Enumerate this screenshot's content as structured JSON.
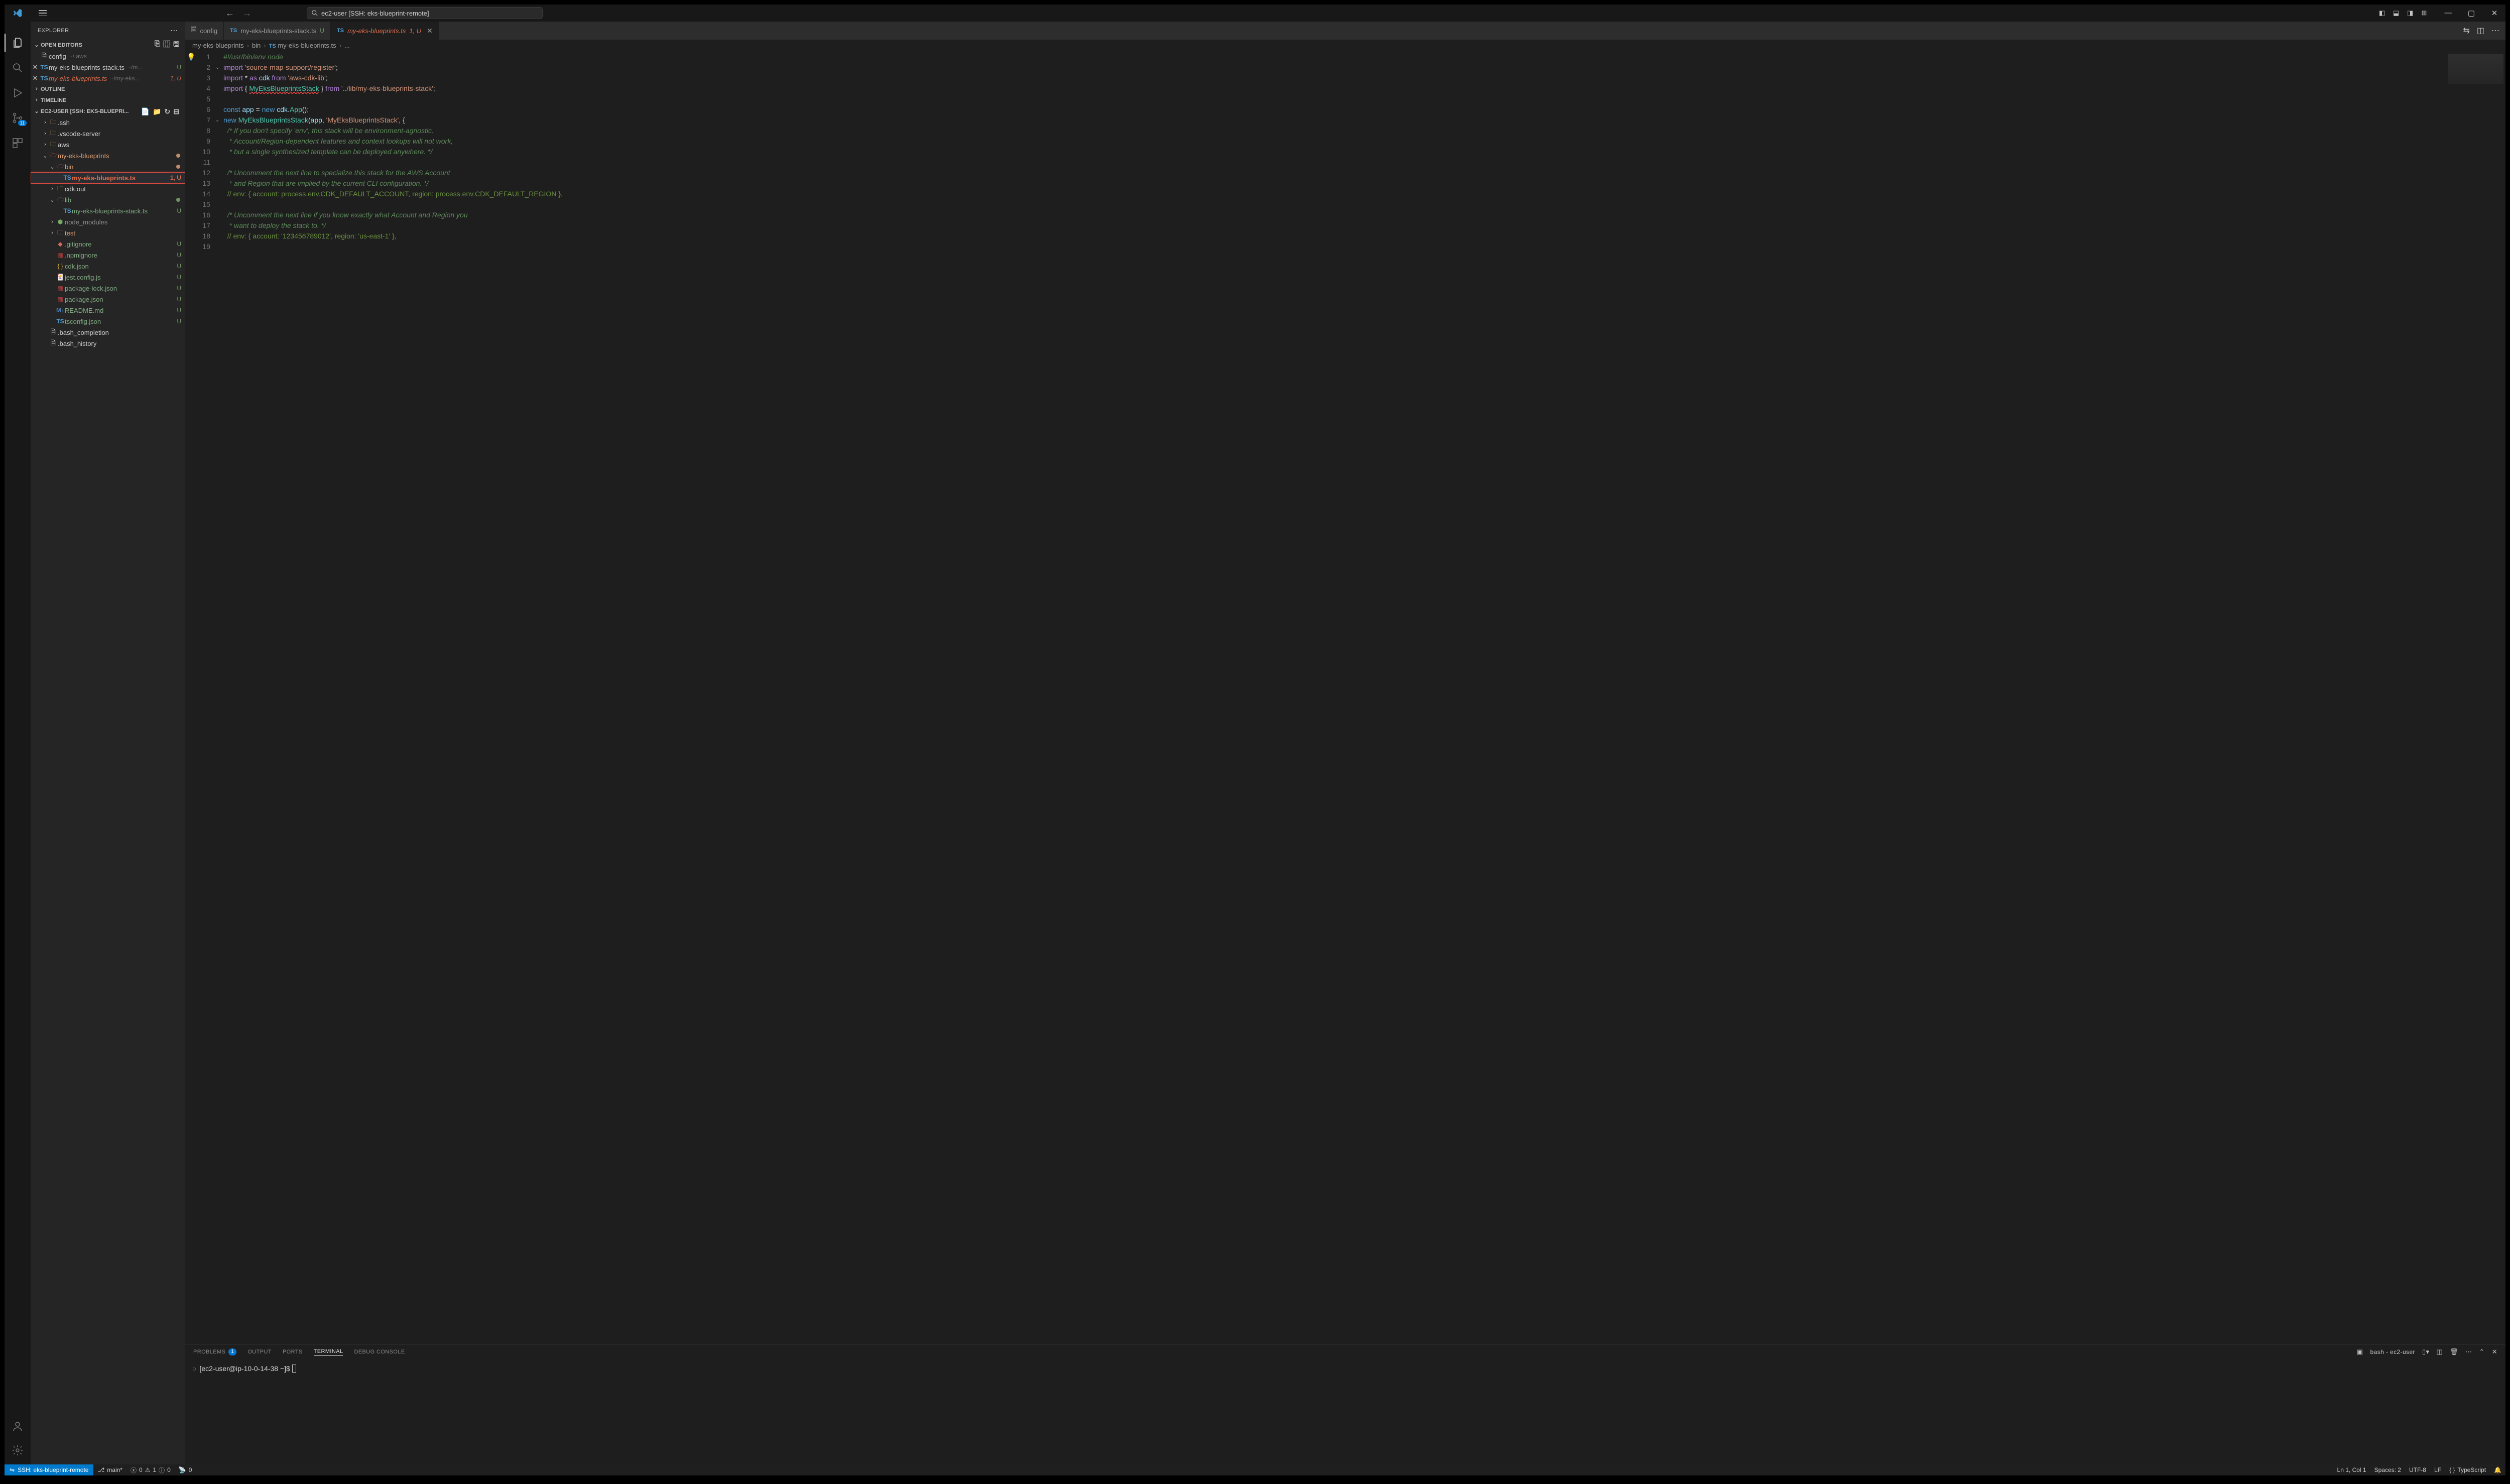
{
  "titlebar": {
    "search_text": "ec2-user [SSH: eks-blueprint-remote]"
  },
  "activity": {
    "scm_badge": "11"
  },
  "explorer": {
    "title": "EXPLORER",
    "open_editors_label": "OPEN EDITORS",
    "open_editors": [
      {
        "icon": "file",
        "label": "config",
        "path": "~/.aws"
      },
      {
        "icon": "ts",
        "label": "my-eks-blueprints-stack.ts",
        "path": "~/m...",
        "status": "U",
        "close": true
      },
      {
        "icon": "ts",
        "label": "my-eks-blueprints.ts",
        "path": "~/my-eks...",
        "status": "1, U",
        "close": true,
        "unsaved": true
      }
    ],
    "outline_label": "OUTLINE",
    "timeline_label": "TIMELINE",
    "workspace_label": "EC2-USER [SSH: EKS-BLUEPRI...",
    "tree": [
      {
        "indent": 1,
        "chev": ">",
        "icon": "folder",
        "label": ".ssh",
        "cls": ""
      },
      {
        "indent": 1,
        "chev": ">",
        "icon": "folder",
        "label": ".vscode-server",
        "cls": ""
      },
      {
        "indent": 1,
        "chev": ">",
        "icon": "folder",
        "label": "aws",
        "cls": ""
      },
      {
        "indent": 1,
        "chev": "v",
        "icon": "folder-open-red",
        "label": "my-eks-blueprints",
        "cls": "orange",
        "dot": "#c08d6b"
      },
      {
        "indent": 2,
        "chev": "v",
        "icon": "folder-open-red",
        "label": "bin",
        "cls": "orange",
        "dot": "#c08d6b"
      },
      {
        "indent": 3,
        "chev": "",
        "icon": "ts",
        "label": "my-eks-blueprints.ts",
        "cls": "orange-bright",
        "status": "1, U",
        "sel": true
      },
      {
        "indent": 2,
        "chev": ">",
        "icon": "folder",
        "label": "cdk.out",
        "cls": ""
      },
      {
        "indent": 2,
        "chev": "v",
        "icon": "folder-open-green",
        "label": "lib",
        "cls": "green",
        "dot": "#6f9462"
      },
      {
        "indent": 3,
        "chev": "",
        "icon": "ts",
        "label": "my-eks-blueprints-stack.ts",
        "cls": "green",
        "status": "U"
      },
      {
        "indent": 2,
        "chev": ">",
        "icon": "node",
        "label": "node_modules",
        "cls": "dim"
      },
      {
        "indent": 2,
        "chev": ">",
        "icon": "folder-red",
        "label": "test",
        "cls": "orange"
      },
      {
        "indent": 2,
        "chev": "",
        "icon": "git",
        "label": ".gitignore",
        "cls": "green",
        "status": "U"
      },
      {
        "indent": 2,
        "chev": "",
        "icon": "npm",
        "label": ".npmignore",
        "cls": "green",
        "status": "U"
      },
      {
        "indent": 2,
        "chev": "",
        "icon": "json",
        "label": "cdk.json",
        "cls": "green",
        "status": "U"
      },
      {
        "indent": 2,
        "chev": "",
        "icon": "jest",
        "label": "jest.config.js",
        "cls": "green",
        "status": "U"
      },
      {
        "indent": 2,
        "chev": "",
        "icon": "npm",
        "label": "package-lock.json",
        "cls": "green",
        "status": "U"
      },
      {
        "indent": 2,
        "chev": "",
        "icon": "npm",
        "label": "package.json",
        "cls": "green",
        "status": "U"
      },
      {
        "indent": 2,
        "chev": "",
        "icon": "md",
        "label": "README.md",
        "cls": "green",
        "status": "U"
      },
      {
        "indent": 2,
        "chev": "",
        "icon": "ts",
        "label": "tsconfig.json",
        "cls": "green",
        "status": "U"
      },
      {
        "indent": 1,
        "chev": "",
        "icon": "file",
        "label": ".bash_completion",
        "cls": ""
      },
      {
        "indent": 1,
        "chev": "",
        "icon": "file",
        "label": ".bash_history",
        "cls": ""
      }
    ]
  },
  "tabs": {
    "items": [
      {
        "icon": "file",
        "label": "config"
      },
      {
        "icon": "ts",
        "label": "my-eks-blueprints-stack.ts",
        "suffix": "U"
      },
      {
        "icon": "ts",
        "label": "my-eks-blueprints.ts",
        "suffix": "1, U",
        "active": true,
        "unsaved": true
      }
    ]
  },
  "breadcrumb": {
    "parts": [
      "my-eks-blueprints",
      "bin",
      "my-eks-blueprints.ts",
      "..."
    ],
    "ts_index": 2
  },
  "code": {
    "lines": [
      {
        "n": 1,
        "html": "<span class='cmti'>#!/usr/bin/env node</span>"
      },
      {
        "n": 2,
        "fold": "v",
        "html": "<span class='kw'>import</span> <span class='str'>'source-map-support/register'</span><span class='pun'>;</span>"
      },
      {
        "n": 3,
        "html": "<span class='kw'>import</span> <span class='pun'>*</span> <span class='kw'>as</span> <span class='var'>cdk</span> <span class='kw'>from</span> <span class='str'>'aws-cdk-lib'</span><span class='pun'>;</span>"
      },
      {
        "n": 4,
        "html": "<span class='kw'>import</span> <span class='pun'>{</span> <span class='err'>MyEksBlueprintsStack</span> <span class='pun'>}</span> <span class='kw'>from</span> <span class='str'>'../lib/my-eks-blueprints-stack'</span><span class='pun'>;</span>"
      },
      {
        "n": 5,
        "html": ""
      },
      {
        "n": 6,
        "html": "<span class='kw2'>const</span> <span class='var'>app</span> <span class='pun'>=</span> <span class='kw2'>new</span> <span class='var'>cdk</span><span class='pun'>.</span><span class='cls'>App</span><span class='pun'>();</span>"
      },
      {
        "n": 7,
        "fold": "v",
        "html": "<span class='kw2'>new</span> <span class='cls'>MyEksBlueprintsStack</span><span class='pun'>(</span><span class='var'>app</span><span class='pun'>,</span> <span class='str'>'MyEksBlueprintsStack'</span><span class='pun'>, {</span>"
      },
      {
        "n": 8,
        "html": "  <span class='cmti'>/* If you don't specify 'env', this stack will be environment-agnostic.</span>"
      },
      {
        "n": 9,
        "html": "  <span class='cmti'> * Account/Region-dependent features and context lookups will not work,</span>"
      },
      {
        "n": 10,
        "html": "  <span class='cmti'> * but a single synthesized template can be deployed anywhere. */</span>"
      },
      {
        "n": 11,
        "html": ""
      },
      {
        "n": 12,
        "html": "  <span class='cmti'>/* Uncomment the next line to specialize this stack for the AWS Account</span>"
      },
      {
        "n": 13,
        "html": "  <span class='cmti'> * and Region that are implied by the current CLI configuration. */</span>"
      },
      {
        "n": 14,
        "html": "  <span class='cmt'>// env: { account: process.env.CDK_DEFAULT_ACCOUNT, region: process.env.CDK_DEFAULT_REGION },</span>"
      },
      {
        "n": 15,
        "html": ""
      },
      {
        "n": 16,
        "html": "  <span class='cmti'>/* Uncomment the next line if you know exactly what Account and Region you</span>"
      },
      {
        "n": 17,
        "html": "  <span class='cmti'> * want to deploy the stack to. */</span>"
      },
      {
        "n": 18,
        "html": "  <span class='cmt'>// env: { account: '123456789012', region: 'us-east-1' },</span>"
      },
      {
        "n": 19,
        "html": ""
      }
    ]
  },
  "panel": {
    "tabs": {
      "problems": "PROBLEMS",
      "problems_badge": "1",
      "output": "OUTPUT",
      "ports": "PORTS",
      "terminal": "TERMINAL",
      "debug": "DEBUG CONSOLE"
    },
    "terminal_name": "bash - ec2-user",
    "prompt": "[ec2-user@ip-10-0-14-38 ~]$"
  },
  "statusbar": {
    "remote": "SSH: eks-blueprint-remote",
    "branch": "main*",
    "errors": "0",
    "warnings": "1",
    "info": "0",
    "ports": "0",
    "ln_col": "Ln 1, Col 1",
    "spaces": "Spaces: 2",
    "encoding": "UTF-8",
    "eol": "LF",
    "lang": "TypeScript"
  }
}
